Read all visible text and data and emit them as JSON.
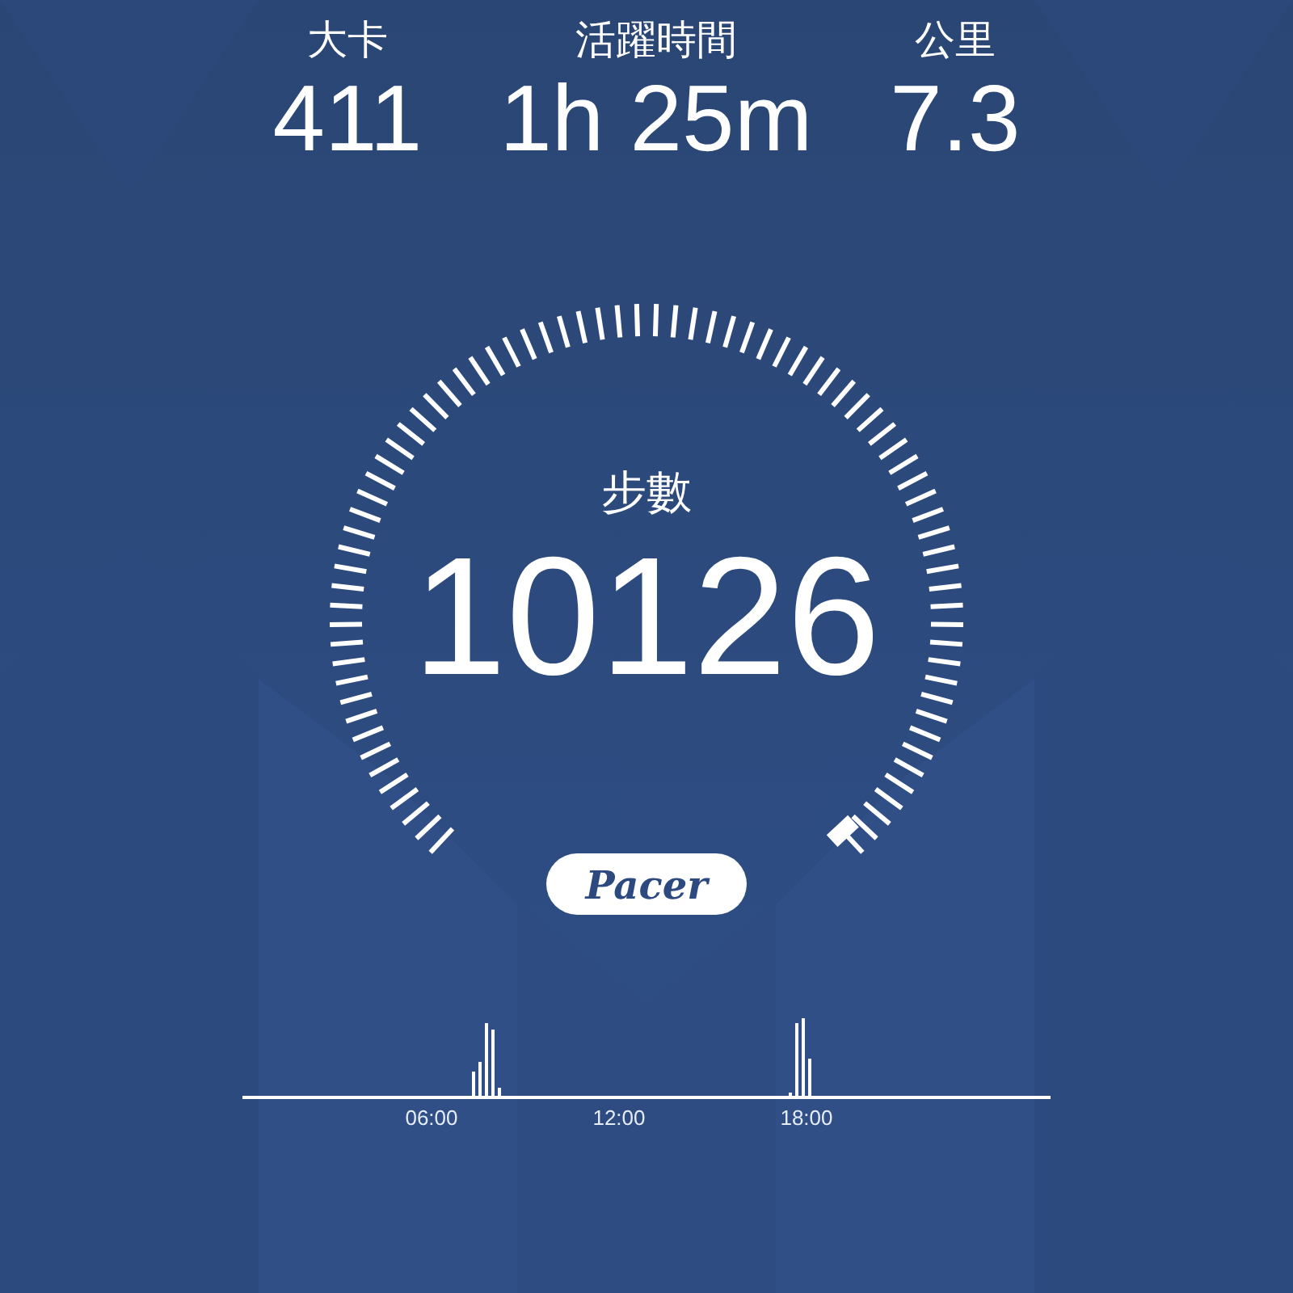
{
  "stats": [
    {
      "label": "大卡",
      "value": "411"
    },
    {
      "label": "活躍時間",
      "value": "1h 25m"
    },
    {
      "label": "公里",
      "value": "7.3"
    }
  ],
  "gauge": {
    "label": "步數",
    "value": "10126"
  },
  "logo": "Pacer",
  "activity_chart": {
    "time_labels": [
      "06:00",
      "12:00",
      "18:00"
    ]
  }
}
